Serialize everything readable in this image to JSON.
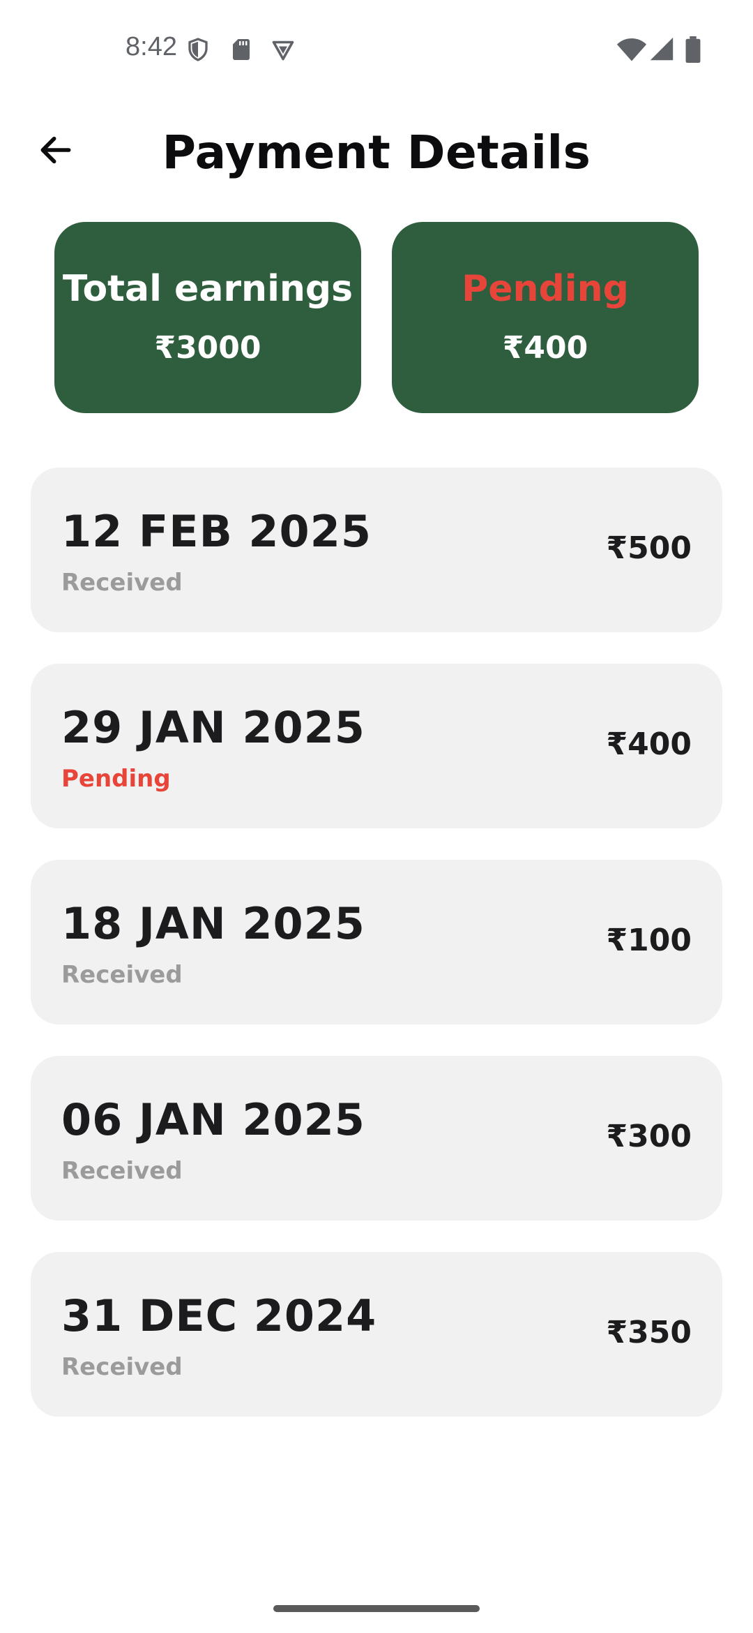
{
  "status_bar": {
    "time": "8:42",
    "left_icons": [
      "shield-icon",
      "sd-card-icon",
      "vpn-icon"
    ],
    "right_icons": [
      "wifi-icon",
      "cellular-signal-icon",
      "battery-icon"
    ]
  },
  "header": {
    "back_icon": "arrow-left-icon",
    "title": "Payment Details"
  },
  "summary": {
    "total": {
      "label": "Total earnings",
      "value": "₹3000"
    },
    "pending": {
      "label": "Pending",
      "value": "₹400"
    }
  },
  "transactions": [
    {
      "date": "12 FEB 2025",
      "status": "Received",
      "amount": "₹500"
    },
    {
      "date": "29 JAN 2025",
      "status": "Pending",
      "amount": "₹400"
    },
    {
      "date": "18 JAN 2025",
      "status": "Received",
      "amount": "₹100"
    },
    {
      "date": "06 JAN 2025",
      "status": "Received",
      "amount": "₹300"
    },
    {
      "date": "31 DEC 2024",
      "status": "Received",
      "amount": "₹350"
    }
  ],
  "colors": {
    "card_green": "#2f5e3f",
    "pending_red": "#e8453a",
    "received_gray": "#9b9b9b",
    "row_bg": "#f1f1f1"
  }
}
